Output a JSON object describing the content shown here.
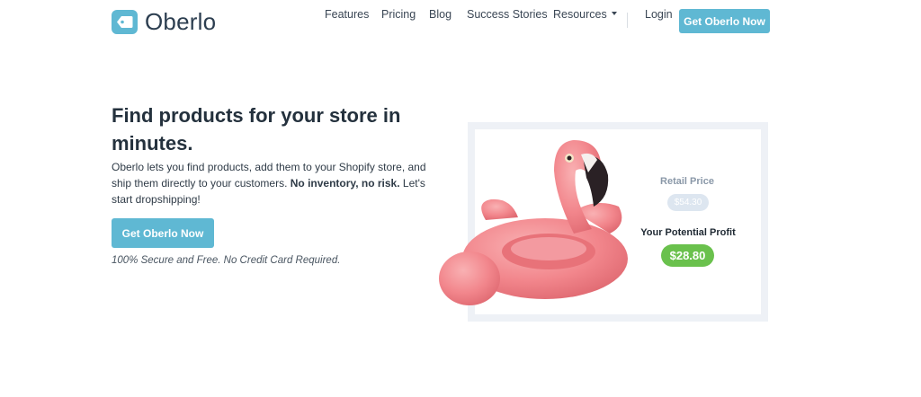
{
  "header": {
    "logo_text": "Oberlo",
    "nav": {
      "features": "Features",
      "pricing": "Pricing",
      "blog": "Blog",
      "success_stories": "Success Stories",
      "resources": "Resources",
      "login": "Login"
    },
    "cta_label": "Get Oberlo Now"
  },
  "hero": {
    "title": "Find products for your store in minutes.",
    "description_start": "Oberlo lets you find products, add them to your Shopify store, and ship them directly to your customers. ",
    "description_bold": "No inventory, no risk.",
    "description_end": " Let's start dropshipping!",
    "cta_label": "Get Oberlo Now",
    "note": "100% Secure and Free. No Credit Card Required."
  },
  "product_card": {
    "retail_label": "Retail Price",
    "retail_price": "$54.30",
    "profit_label": "Your Potential Profit",
    "profit_value": "$28.80",
    "product_image": "pink-flamingo-float-icon"
  },
  "colors": {
    "brand": "#5fb8d3",
    "profit_green": "#6ac14d",
    "card_frame": "#eef1f6",
    "retail_pill": "#dde6f0",
    "flamingo_pink": "#f2868c"
  }
}
